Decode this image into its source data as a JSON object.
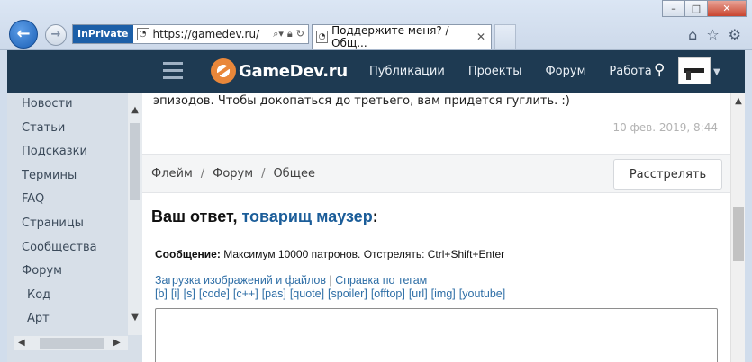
{
  "browser": {
    "inprivate_label": "InPrivate",
    "url": "https://gamedev.ru/",
    "tab_title": "Поддержите меня? / Общ...",
    "window_buttons": {
      "minimize": "–",
      "maximize": "□",
      "close": "✕"
    }
  },
  "site": {
    "logo_text": "GameDev.ru",
    "nav": [
      {
        "label": "Публикации"
      },
      {
        "label": "Проекты"
      },
      {
        "label": "Форум"
      },
      {
        "label": "Работа"
      }
    ]
  },
  "sidebar": {
    "items": [
      {
        "label": "Новости"
      },
      {
        "label": "Статьи"
      },
      {
        "label": "Подсказки"
      },
      {
        "label": "Термины"
      },
      {
        "label": "FAQ"
      },
      {
        "label": "Страницы"
      },
      {
        "label": "Сообщества"
      },
      {
        "label": "Форум"
      },
      {
        "label": "Код"
      },
      {
        "label": "Арт"
      }
    ]
  },
  "post": {
    "text_tail": "эпизодов. Чтобы докопаться до третьего, вам придется гуглить. :)",
    "date": "10 фев. 2019, 8:44"
  },
  "breadcrumb": {
    "items": [
      "Флейм",
      "Форум",
      "Общее"
    ],
    "separator": "/"
  },
  "actions": {
    "shoot_label": "Расстрелять"
  },
  "reply": {
    "title_prefix": "Ваш ответ, ",
    "username": "товарищ маузер",
    "title_suffix": ":",
    "message_label": "Сообщение:",
    "message_hint": "Максимум 10000 патронов. Отстрелять: Ctrl+Shift+Enter",
    "upload_link": "Загрузка изображений и файлов",
    "link_separator": "|",
    "help_link": "Справка по тегам",
    "tags": [
      "[b]",
      "[i]",
      "[s]",
      "[code]",
      "[c++]",
      "[pas]",
      "[quote]",
      "[spoiler]",
      "[offtop]",
      "[url]",
      "[img]",
      "[youtube]"
    ]
  }
}
